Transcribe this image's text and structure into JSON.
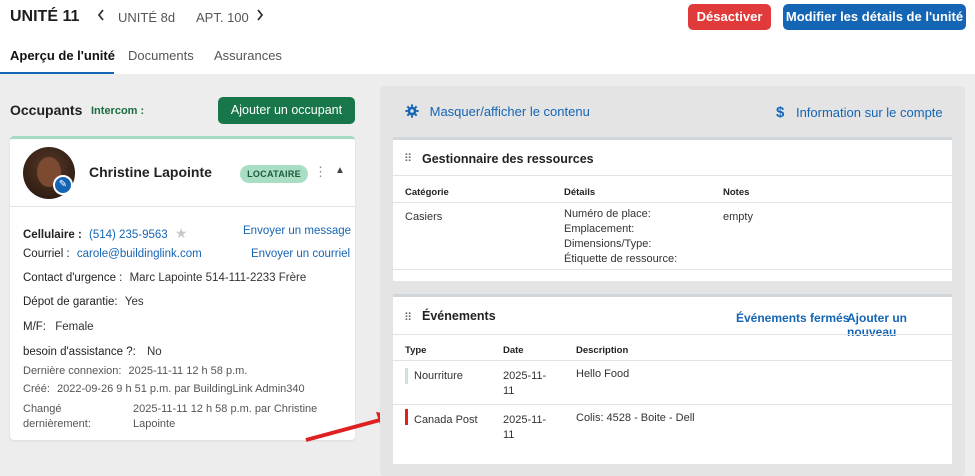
{
  "header": {
    "unit_title": "UNITÉ 11",
    "prev_unit": "UNITÉ 8d",
    "next_unit": "APT. 100",
    "deactivate_label": "Désactiver",
    "edit_details_label": "Modifier les détails de l'unité"
  },
  "tabs": [
    {
      "label": "Aperçu de l'unité",
      "active": true
    },
    {
      "label": "Documents",
      "active": false
    },
    {
      "label": "Assurances",
      "active": false
    }
  ],
  "occupants": {
    "title": "Occupants",
    "intercom_label": "Intercom :",
    "add_button": "Ajouter un occupant",
    "card": {
      "name": "Christine Lapointe",
      "badge": "LOCATAIRE",
      "cell_label": "Cellulaire :",
      "cell_value": "(514) 235-9563",
      "send_message": "Envoyer un message",
      "email_label": "Courriel :",
      "email_value": "carole@buildinglink.com",
      "send_email": "Envoyer un courriel",
      "emergency_label": "Contact d'urgence :",
      "emergency_value": "Marc Lapointe 514-111-2233 Frère",
      "deposit_label": "Dépot de garantie:",
      "deposit_value": "Yes",
      "gender_label": "M/F:",
      "gender_value": "Female",
      "assist_label": "besoin d'assistance ?:",
      "assist_value": "No",
      "last_login_label": "Dernière connexion:",
      "last_login_value": "2025-11-11 12 h 58 p.m.",
      "created_label": "Créé:",
      "created_value": "2022-09-26 9 h 51 p.m. par BuildingLink Admin340",
      "changed_label_1": "Changé",
      "changed_label_2": "dernièrement:",
      "changed_value_1": "2025-11-11 12 h 58 p.m. par Christine",
      "changed_value_2": "Lapointe"
    }
  },
  "right": {
    "toggle_label": "Masquer/afficher le contenu",
    "account_label": "Information sur le compte",
    "resources": {
      "title": "Gestionnaire des ressources",
      "columns": [
        "Catégorie",
        "Détails",
        "Notes"
      ],
      "row": {
        "category": "Casiers",
        "details": [
          "Numéro de place:",
          "Emplacement:",
          "Dimensions/Type:",
          "Étiquette de ressource:"
        ],
        "notes": "empty"
      }
    },
    "events": {
      "title": "Événements",
      "closed_link": "Événements fermés",
      "add_link": "Ajouter un nouveau",
      "columns": [
        "Type",
        "Date",
        "Description"
      ],
      "rows": [
        {
          "type": "Nourriture",
          "date_1": "2025-11-",
          "date_2": "11",
          "description": "Hello Food",
          "color": "#c8e6d5"
        },
        {
          "type": "Canada Post",
          "date_1": "2025-11-",
          "date_2": "11",
          "description": "Colis: 4528 - Boite - Dell",
          "color": "#e02020"
        }
      ]
    }
  },
  "colors": {
    "primary": "#1565b5",
    "danger": "#e03a3a",
    "success": "#18774a",
    "annotation_arrow": "#e02020"
  }
}
